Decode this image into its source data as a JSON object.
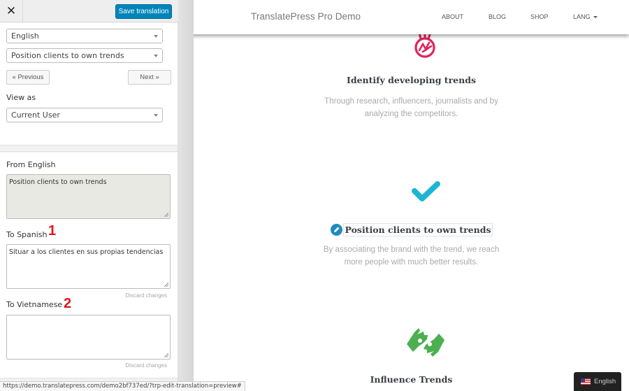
{
  "sidebar": {
    "close_label": "✕",
    "save_label": "Save translation",
    "language_select": "English",
    "string_select": "Position clients to own trends",
    "previous_label": "« Previous",
    "next_label": "Next »",
    "view_as_label": "View as",
    "view_as_select": "Current User",
    "from_label": "From English",
    "from_value": "Position clients to own trends",
    "targets": [
      {
        "label": "To Spanish",
        "marker": "1",
        "value": "Situar a los clientes en sus propias tendencias",
        "discard_label": "Discard changes"
      },
      {
        "label": "To Vietnamese",
        "marker": "2",
        "value": "",
        "discard_label": "Discard changes"
      }
    ]
  },
  "status_bar": {
    "url": "https://demo.translatepress.com/demo2bf737ed/?trp-edit-translation=preview#"
  },
  "site": {
    "title": "TranslatePress Pro Demo",
    "nav": [
      {
        "label": "ABOUT"
      },
      {
        "label": "BLOG"
      },
      {
        "label": "SHOP"
      },
      {
        "label": "LANG",
        "has_dropdown": true
      }
    ],
    "features": [
      {
        "icon": "peace-hand-icon",
        "icon_color": "#e0245e",
        "title": "Identify developing trends",
        "desc_lines": [
          "Through research, influencers, journalists and by",
          "analyzing the competitors."
        ]
      },
      {
        "icon": "checkmark-icon",
        "icon_color": "#1bb6d1",
        "title": "Position clients to own trends",
        "desc_lines": [
          "By associating the brand with the trend, we reach",
          "more people with much better results."
        ]
      },
      {
        "icon": "sign-language-icon",
        "icon_color": "#4caf50",
        "title": "Influence Trends",
        "desc_lines": []
      }
    ],
    "language_switcher": {
      "label": "English",
      "flag": "us-flag-icon"
    }
  },
  "colors": {
    "primary_button": "#0085ba",
    "edit_pencil": "#1e8cbe",
    "marker_red": "#e0131d"
  }
}
